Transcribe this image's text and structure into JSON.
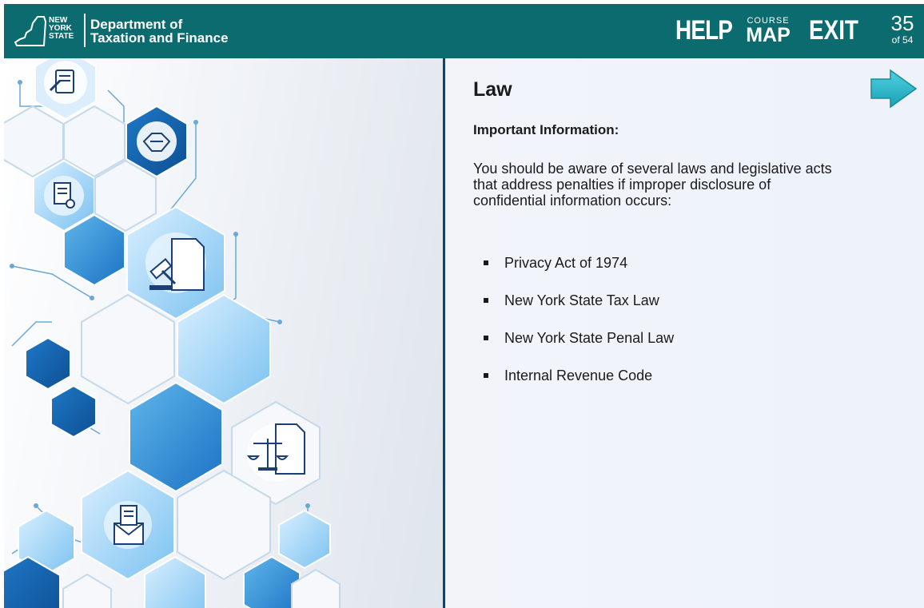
{
  "header": {
    "logo_lines": [
      "NEW",
      "YORK",
      "STATE"
    ],
    "department_line1": "Department of",
    "department_line2": "Taxation and Finance",
    "help_label": "HELP",
    "course_map_small": "COURSE",
    "course_map_big": "MAP",
    "exit_label": "EXIT",
    "page_current": "35",
    "page_total": "of 54",
    "color": "#0b6b6e"
  },
  "content": {
    "title": "Law",
    "subheading": "Important Information:",
    "paragraph": "You should be aware of several laws and legislative acts that address penalties if improper disclosure of confidential information occurs:",
    "bullets": [
      "Privacy Act of 1974",
      "New York State Tax Law",
      "New York State Penal Law",
      "Internal Revenue Code"
    ]
  },
  "navigation": {
    "next_icon": "arrow-right-icon",
    "next_color": "#29b5c8"
  },
  "graphic_icons": [
    "document-pen-icon",
    "handshake-icon",
    "certificate-icon",
    "gavel-icon",
    "scales-icon",
    "mail-icon"
  ]
}
